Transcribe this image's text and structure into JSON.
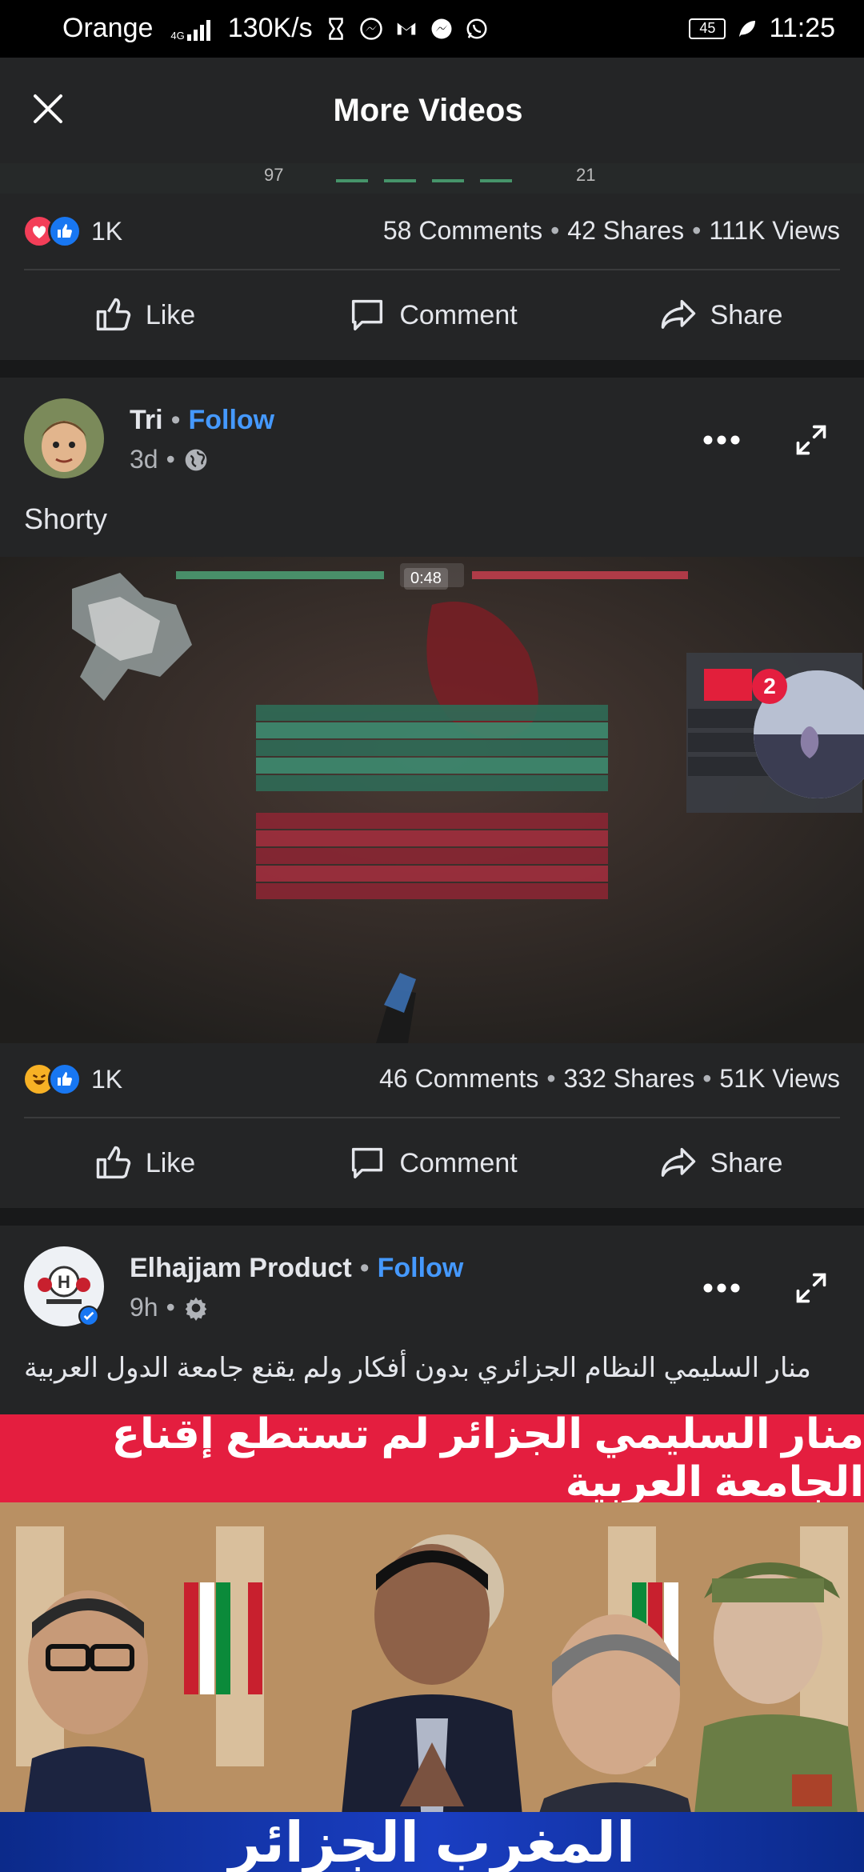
{
  "status_bar": {
    "carrier": "Orange",
    "network": "4G",
    "speed": "130K/s",
    "battery": "45",
    "time": "11:25"
  },
  "header": {
    "title": "More Videos"
  },
  "posts": [
    {
      "reactions": [
        "love",
        "like"
      ],
      "reaction_count": "1K",
      "comments": "58 Comments",
      "shares": "42 Shares",
      "views": "111K Views"
    },
    {
      "author": "Tri",
      "follow_label": "Follow",
      "time": "3d",
      "privacy_icon": "globe-icon",
      "caption": "Shorty",
      "video_duration": "0:48",
      "reactions": [
        "haha",
        "like"
      ],
      "reaction_count": "1K",
      "comments": "46 Comments",
      "shares": "332 Shares",
      "views": "51K Views"
    },
    {
      "author": "Elhajjam Product",
      "follow_label": "Follow",
      "time": "9h",
      "privacy_icon": "gear-icon",
      "caption": "منار السليمي النظام الجزائري  بدون أفكار ولم يقنع جامعة الدول العربية",
      "thumbnail_banner": "منار السليمي الجزائر لم تستطع إقناع الجامعة العربية",
      "thumbnail_footer": "المغرب الجزائر"
    }
  ],
  "actions": {
    "like": "Like",
    "comment": "Comment",
    "share": "Share"
  },
  "chat_bubble": {
    "badge": "2"
  },
  "colors": {
    "background": "#18191a",
    "panel": "#242526",
    "link": "#4599ff",
    "like_blue": "#1877f2",
    "love_red": "#f33e58",
    "haha_yellow": "#f7b125",
    "badge_red": "#e41e3f"
  }
}
